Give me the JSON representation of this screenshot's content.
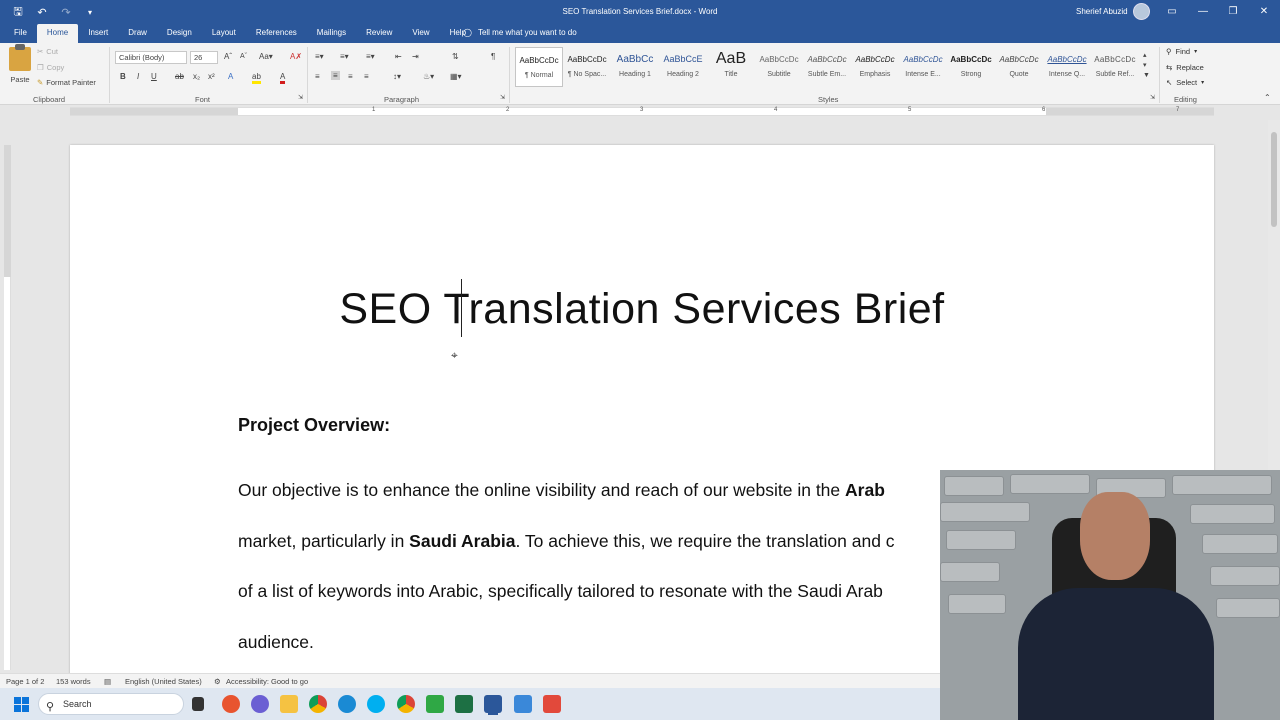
{
  "window": {
    "doc_title": "SEO Translation Services Brief.docx  -  Word",
    "user_name": "Sherief Abuzid"
  },
  "tabs": [
    "File",
    "Home",
    "Insert",
    "Draw",
    "Design",
    "Layout",
    "References",
    "Mailings",
    "Review",
    "View",
    "Help"
  ],
  "tell_me": "Tell me what you want to do",
  "clipboard": {
    "paste": "Paste",
    "cut": "Cut",
    "copy": "Copy",
    "format_painter": "Format Painter",
    "label": "Clipboard"
  },
  "font": {
    "name": "Calibri (Body)",
    "size": "26",
    "label": "Font"
  },
  "paragraph": {
    "label": "Paragraph"
  },
  "styles": {
    "label": "Styles",
    "items": [
      {
        "preview": "AaBbCcDc",
        "name": "¶ Normal"
      },
      {
        "preview": "AaBbCcDc",
        "name": "¶ No Spac..."
      },
      {
        "preview": "AaBbCc",
        "name": "Heading 1"
      },
      {
        "preview": "AaBbCcE",
        "name": "Heading 2"
      },
      {
        "preview": "AaB",
        "name": "Title"
      },
      {
        "preview": "AaBbCcDc",
        "name": "Subtitle"
      },
      {
        "preview": "AaBbCcDc",
        "name": "Subtle Em..."
      },
      {
        "preview": "AaBbCcDc",
        "name": "Emphasis"
      },
      {
        "preview": "AaBbCcDc",
        "name": "Intense E..."
      },
      {
        "preview": "AaBbCcDc",
        "name": "Strong"
      },
      {
        "preview": "AaBbCcDc",
        "name": "Quote"
      },
      {
        "preview": "AaBbCcDc",
        "name": "Intense Q..."
      },
      {
        "preview": "AaBbCcDc",
        "name": "Subtle Ref..."
      }
    ]
  },
  "editing": {
    "label": "Editing",
    "find": "Find",
    "replace": "Replace",
    "select": "Select"
  },
  "document": {
    "heading": "SEO Translation Services Brief",
    "section_title": "Project Overview:",
    "lines": [
      {
        "pre": "Our objective is to enhance the online visibility and reach of our website in the ",
        "bold": "Arab",
        "post": ""
      },
      {
        "pre": "market, particularly in ",
        "bold": "Saudi Arabia",
        "post": ". To achieve this, we require the translation and c"
      },
      {
        "pre": "of a list of keywords into Arabic, specifically tailored to resonate with the Saudi Arab",
        "bold": "",
        "post": ""
      },
      {
        "pre": "audience.",
        "bold": "",
        "post": ""
      }
    ]
  },
  "status": {
    "page": "Page 1 of 2",
    "words": "153 words",
    "language": "English (United States)",
    "accessibility": "Accessibility: Good to go"
  },
  "taskbar": {
    "search_placeholder": "Search"
  },
  "colors": {
    "brand": "#2b579a"
  }
}
